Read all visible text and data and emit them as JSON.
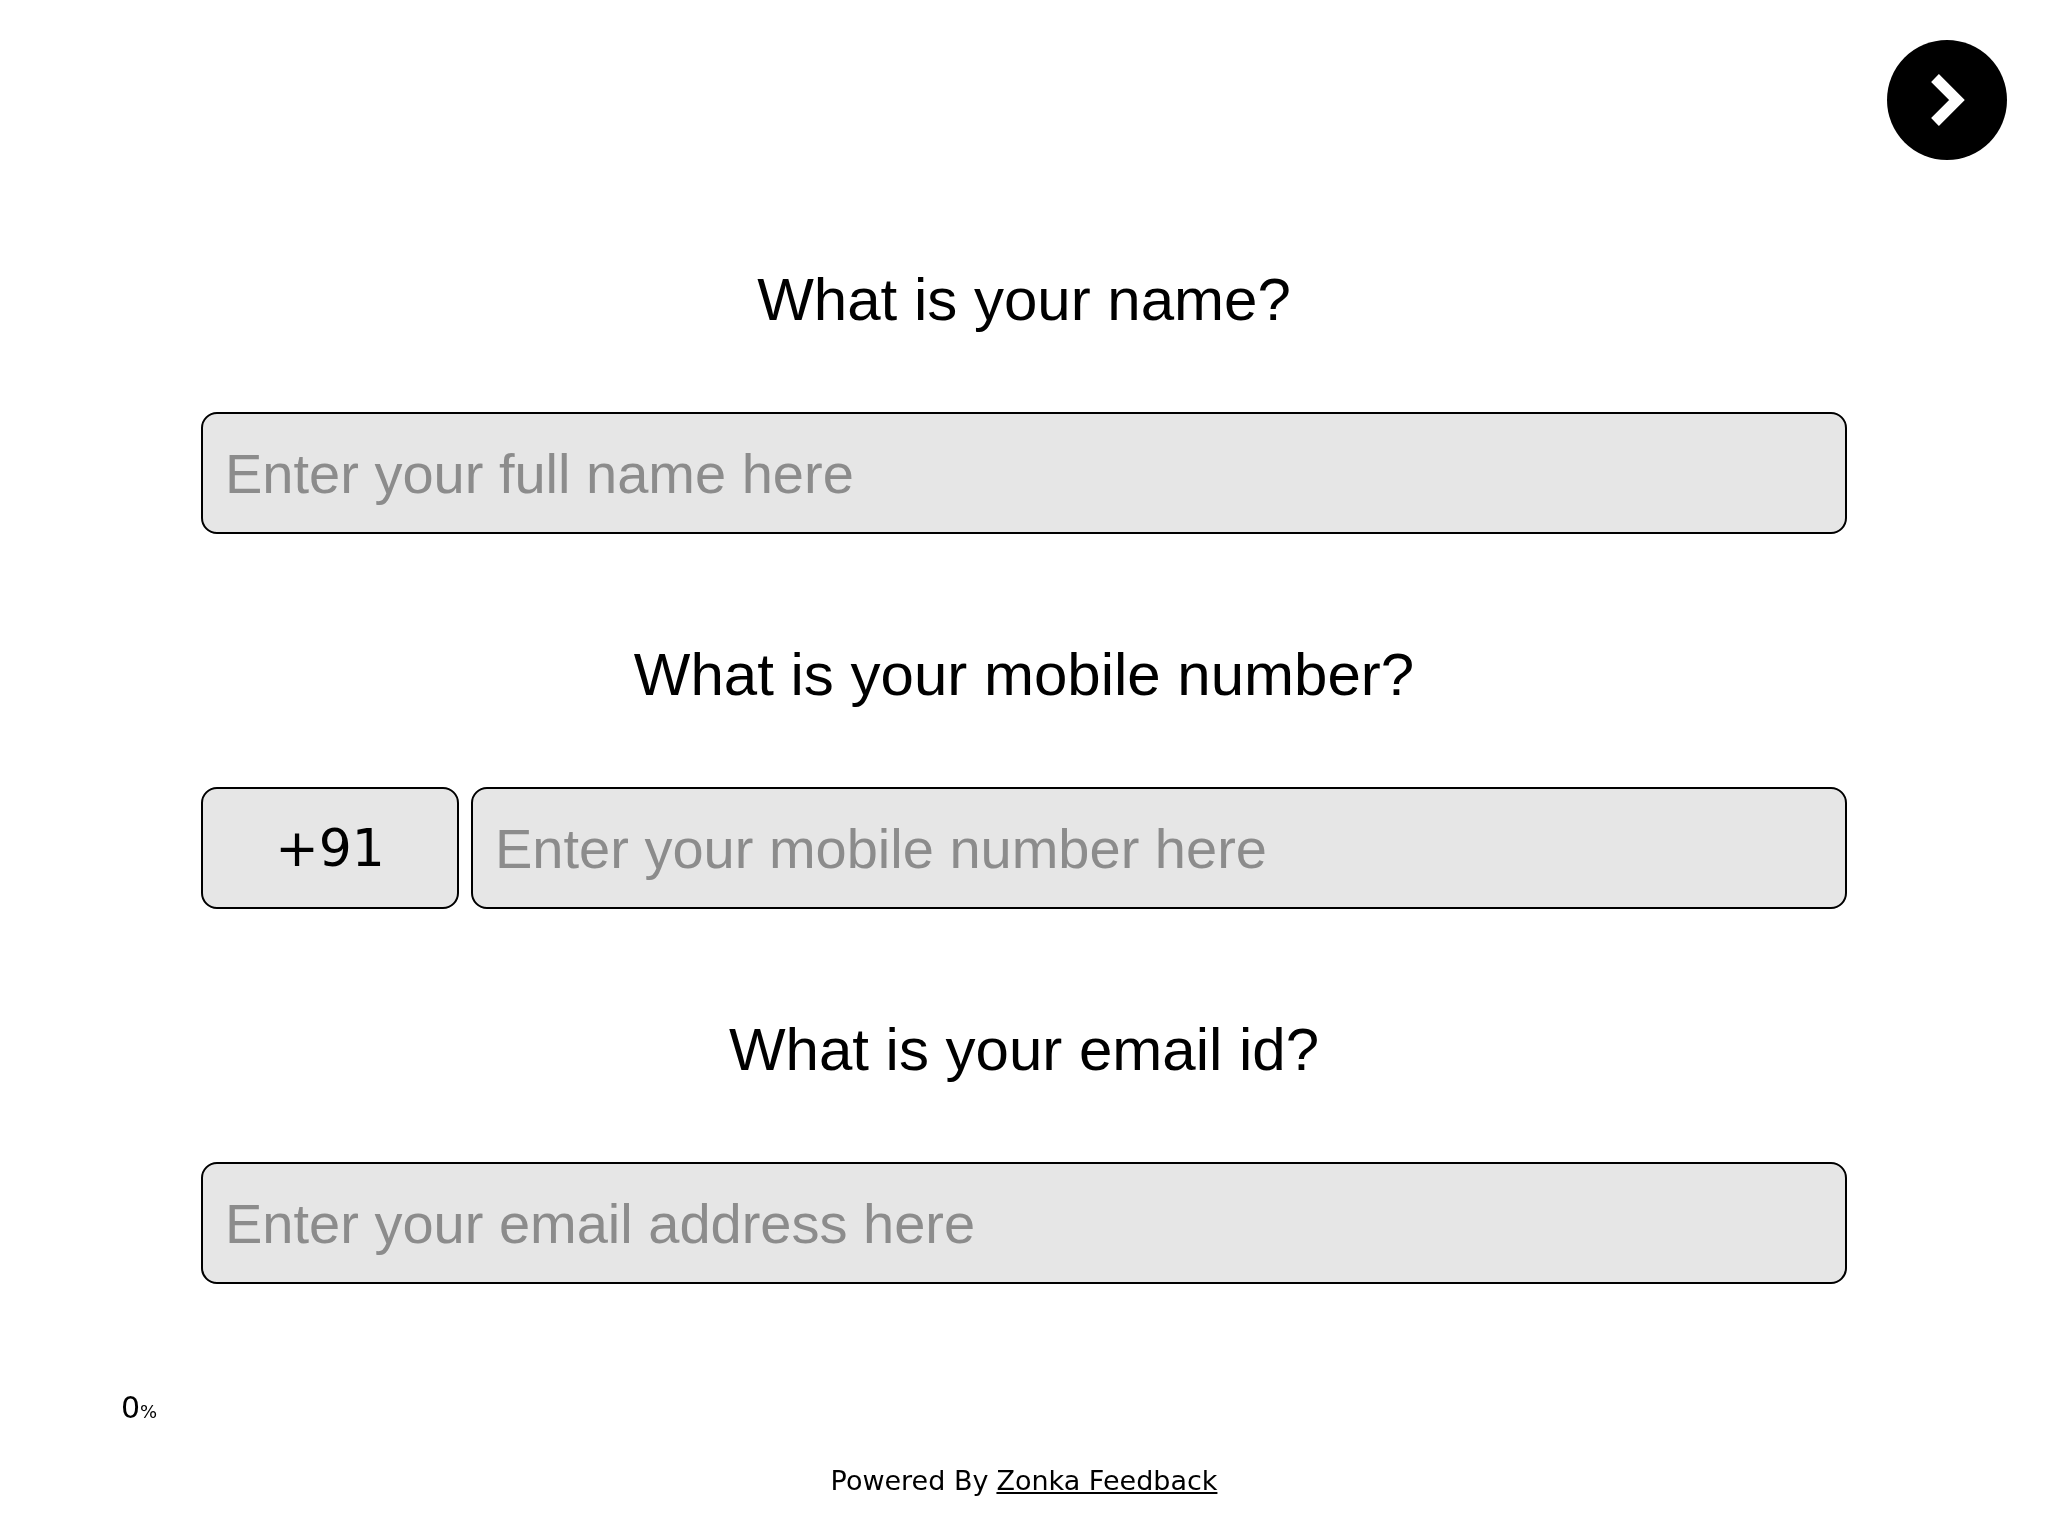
{
  "questions": [
    {
      "kind": "text",
      "title": "What is your name?",
      "placeholder": "Enter your full name here"
    },
    {
      "kind": "phone",
      "title": "What is your mobile number?",
      "prefix": "+91",
      "placeholder": "Enter your mobile number here"
    },
    {
      "kind": "text",
      "title": "What is your email id?",
      "placeholder": "Enter your email address here"
    }
  ],
  "progress": {
    "value": "0",
    "unit": "%"
  },
  "footer": {
    "text": "Powered By",
    "link": "Zonka Feedback"
  }
}
